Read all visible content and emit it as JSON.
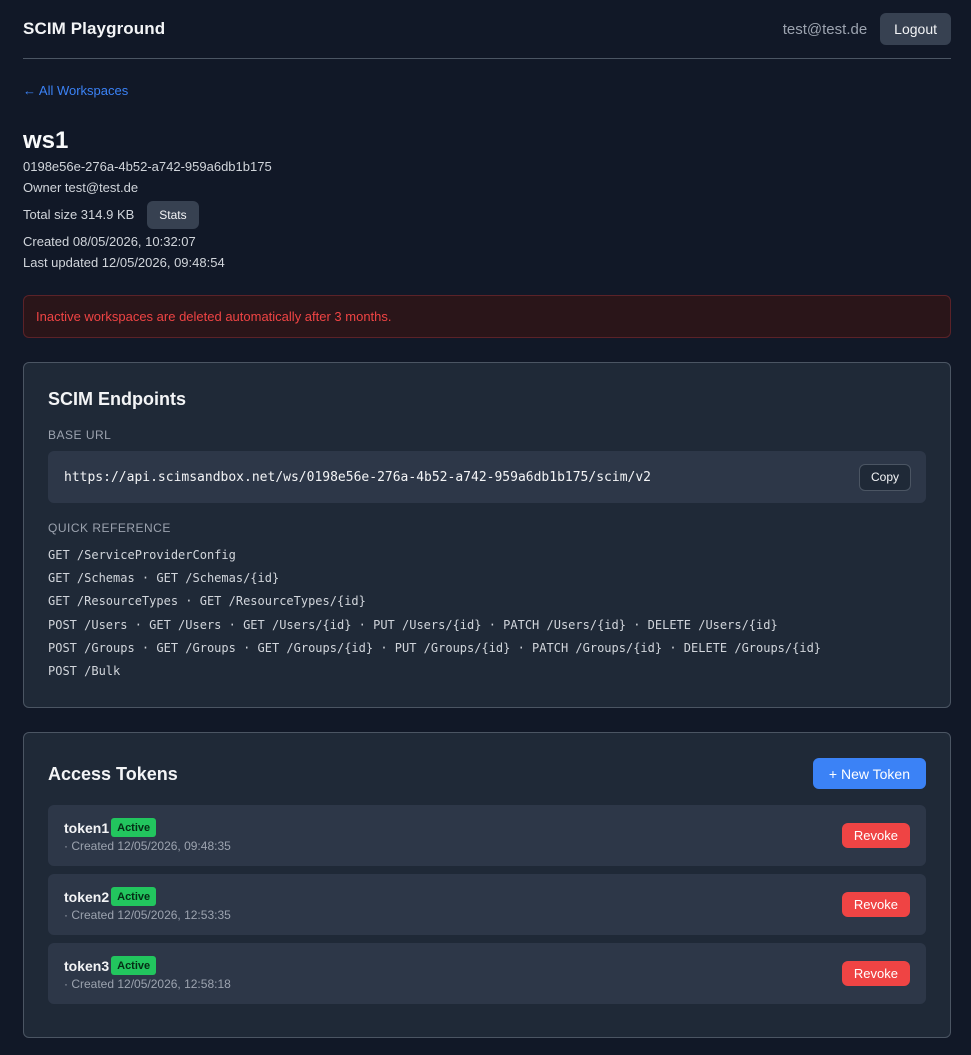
{
  "header": {
    "title": "SCIM Playground",
    "user_email": "test@test.de",
    "logout_label": "Logout"
  },
  "nav": {
    "back_link": "← All Workspaces"
  },
  "workspace": {
    "name": "ws1",
    "id": "0198e56e-276a-4b52-a742-959a6db1b175",
    "owner": "Owner test@test.de",
    "total_size": "Total size 314.9 KB",
    "stats_label": "Stats",
    "created": "Created 08/05/2026, 10:32:07",
    "last_updated": "Last updated 12/05/2026, 09:48:54"
  },
  "alert": {
    "text": "Inactive workspaces are deleted automatically after 3 months.",
    "color": "#ef4444"
  },
  "endpoints": {
    "title": "SCIM Endpoints",
    "base_url_label": "BASE URL",
    "base_url": "https://api.scimsandbox.net/ws/0198e56e-276a-4b52-a742-959a6db1b175/scim/v2",
    "copy_label": "Copy",
    "quick_ref_label": "QUICK REFERENCE",
    "quick_ref": [
      "GET /ServiceProviderConfig",
      "GET /Schemas · GET /Schemas/{id}",
      "GET /ResourceTypes · GET /ResourceTypes/{id}",
      "POST /Users · GET /Users · GET /Users/{id} · PUT /Users/{id} · PATCH /Users/{id} · DELETE /Users/{id}",
      "POST /Groups · GET /Groups · GET /Groups/{id} · PUT /Groups/{id} · PATCH /Groups/{id} · DELETE /Groups/{id}",
      "POST /Bulk"
    ]
  },
  "tokens": {
    "title": "Access Tokens",
    "new_token_label": "+ New Token",
    "revoke_label": "Revoke",
    "items": [
      {
        "name": "token1",
        "status": "Active",
        "created": "· Created 12/05/2026, 09:48:35"
      },
      {
        "name": "token2",
        "status": "Active",
        "created": "· Created 12/05/2026, 12:53:35"
      },
      {
        "name": "token3",
        "status": "Active",
        "created": "· Created 12/05/2026, 12:58:18"
      }
    ]
  },
  "colors": {
    "background": "#111827",
    "card": "#1f2937",
    "accent": "#3b82f6",
    "danger": "#ef4444",
    "success": "#22c55e"
  }
}
